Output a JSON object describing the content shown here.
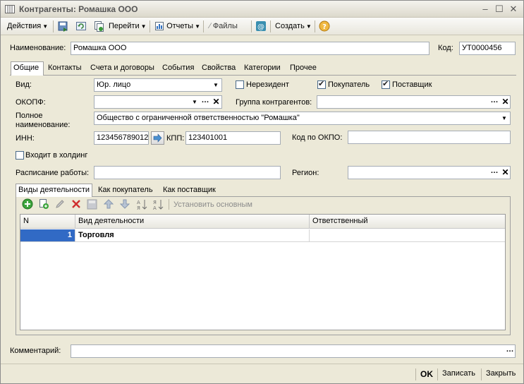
{
  "window": {
    "title": "Контрагенты: Ромашка ООО"
  },
  "toolbar": {
    "actions": "Действия",
    "goto": "Перейти",
    "reports": "Отчеты",
    "files": "Файлы",
    "create": "Создать"
  },
  "header": {
    "name_label": "Наименование:",
    "name_value": "Ромашка ООО",
    "code_label": "Код:",
    "code_value": "УТ0000456"
  },
  "tabs": [
    "Общие",
    "Контакты",
    "Счета и договоры",
    "События",
    "Свойства",
    "Категории",
    "Прочее"
  ],
  "general": {
    "vid_label": "Вид:",
    "vid_value": "Юр. лицо",
    "nonresident_label": "Нерезидент",
    "nonresident_checked": false,
    "buyer_label": "Покупатель",
    "buyer_checked": true,
    "supplier_label": "Поставщик",
    "supplier_checked": true,
    "okopf_label": "ОКОПФ:",
    "okopf_value": "",
    "group_label": "Группа контрагентов:",
    "group_value": "",
    "fullname_label_1": "Полное",
    "fullname_label_2": "наименование:",
    "fullname_value": "Общество с ограниченной ответственностью \"Ромашка\"",
    "inn_label": "ИНН:",
    "inn_value": "123456789012",
    "kpp_label": "КПП:",
    "kpp_value": "123401001",
    "okpo_label": "Код по ОКПО:",
    "okpo_value": "",
    "holding_label": "Входит в холдинг",
    "holding_checked": false,
    "schedule_label": "Расписание работы:",
    "schedule_value": "",
    "region_label": "Регион:",
    "region_value": ""
  },
  "subtabs": [
    "Виды деятельности",
    "Как покупатель",
    "Как поставщик"
  ],
  "activity_toolbar": {
    "set_main": "Установить основным"
  },
  "grid": {
    "columns": [
      "N",
      "Вид деятельности",
      "Ответственный"
    ],
    "rows": [
      {
        "n": "1",
        "activity": "Торговля",
        "responsible": ""
      }
    ]
  },
  "comment": {
    "label": "Комментарий:",
    "value": ""
  },
  "footer": {
    "ok": "OK",
    "save": "Записать",
    "close": "Закрыть"
  },
  "colors": {
    "selection": "#316ac5",
    "window_bg": "#ece9d8"
  }
}
